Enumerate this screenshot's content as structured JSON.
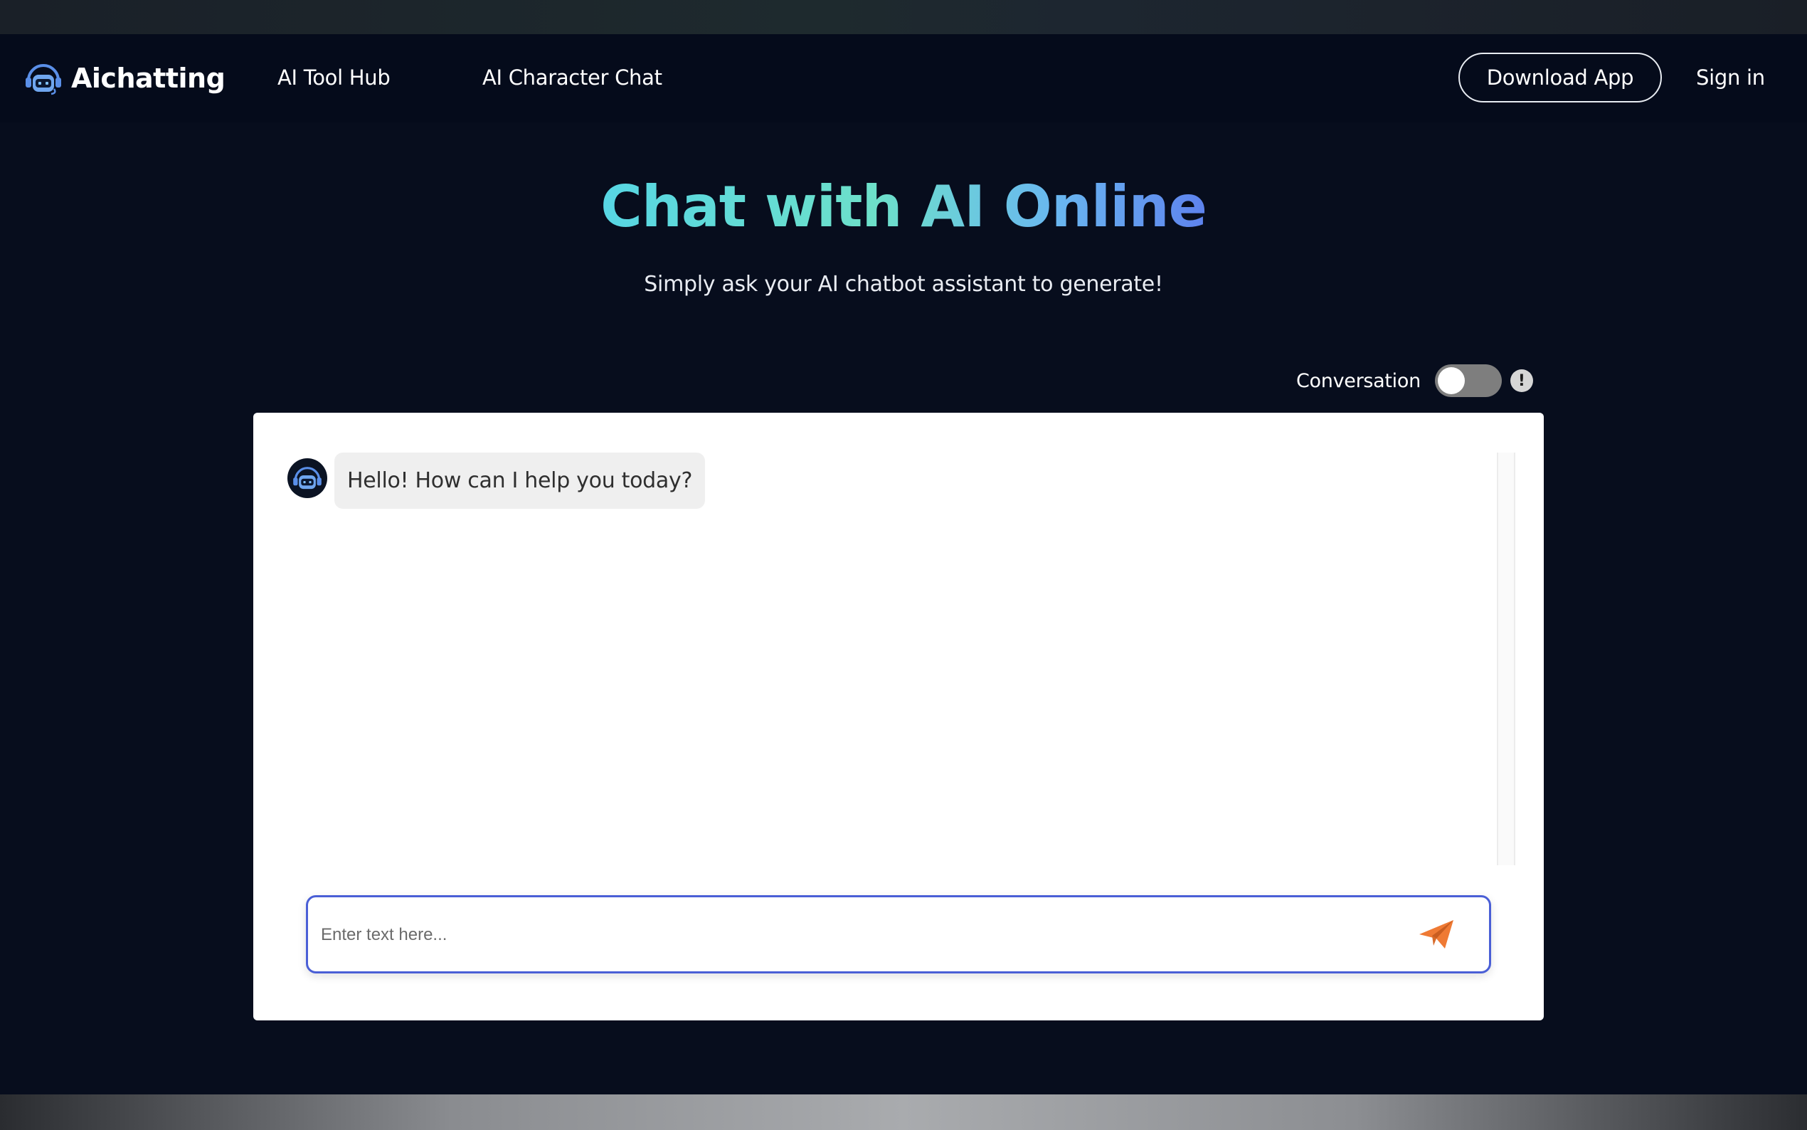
{
  "brand": {
    "name": "Aichatting"
  },
  "nav": {
    "links": [
      {
        "label": "AI Tool Hub"
      },
      {
        "label": "AI Character Chat"
      }
    ],
    "download_label": "Download App",
    "signin_label": "Sign in"
  },
  "hero": {
    "title": "Chat with AI Online",
    "subtitle": "Simply ask your AI chatbot assistant to generate!"
  },
  "conversation": {
    "label": "Conversation",
    "enabled": false,
    "info_symbol": "!"
  },
  "chat": {
    "messages": [
      {
        "sender": "bot",
        "text": "Hello! How can I help you today?"
      }
    ],
    "input_value": "",
    "input_placeholder": "Enter text here..."
  },
  "colors": {
    "page_bg": "#070d1d",
    "title_gradient_start": "#57d6e4",
    "title_gradient_end": "#5e82ee",
    "input_border": "#4a5fd6",
    "send_icon": "#ef7a34"
  },
  "icons": {
    "logo": "robot-headset-icon",
    "avatar": "robot-headset-icon",
    "info": "exclamation-icon",
    "send": "paper-plane-icon"
  }
}
